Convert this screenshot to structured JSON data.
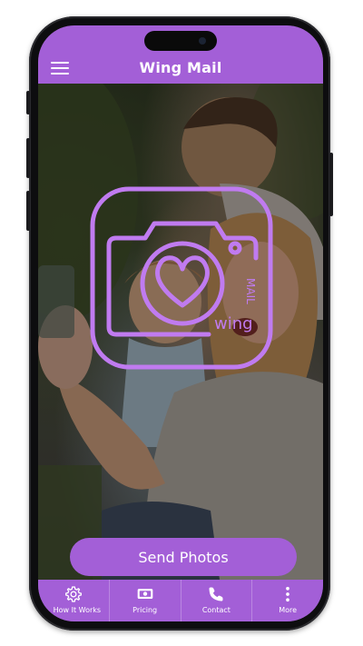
{
  "header": {
    "title": "Wing Mail",
    "menu_icon": "hamburger-menu-icon"
  },
  "hero": {
    "logo_icon": "camera-heart-logo-icon",
    "logo_text": "wing",
    "logo_subtext": "MAIL"
  },
  "actions": {
    "send_label": "Send Photos"
  },
  "tabs": [
    {
      "label": "How It Works",
      "icon": "gear-icon"
    },
    {
      "label": "Pricing",
      "icon": "money-icon"
    },
    {
      "label": "Contact",
      "icon": "phone-icon"
    },
    {
      "label": "More",
      "icon": "more-vertical-icon"
    }
  ],
  "colors": {
    "accent": "#a35fd7",
    "logo_stroke": "#c07bf0",
    "phone_frame": "#0d0d0f"
  }
}
